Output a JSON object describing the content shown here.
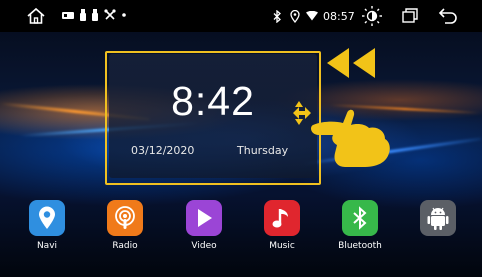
{
  "status_bar": {
    "time": "08:57"
  },
  "clock_widget": {
    "time": "8:42",
    "date": "03/12/2020",
    "day": "Thursday"
  },
  "dock": [
    {
      "label": "Navi",
      "icon": "location-pin-icon",
      "color": "#2f8fe0"
    },
    {
      "label": "Radio",
      "icon": "radio-podcast-icon",
      "color": "#f07a1a"
    },
    {
      "label": "Video",
      "icon": "play-icon",
      "color": "#9b45d6"
    },
    {
      "label": "Music",
      "icon": "music-note-icon",
      "color": "#e0262e"
    },
    {
      "label": "Bluetooth",
      "icon": "bluetooth-icon",
      "color": "#37b84a"
    },
    {
      "label": "",
      "icon": "android-icon",
      "color": "#5b5f66"
    }
  ],
  "colors": {
    "highlight": "#f0c020",
    "status_bar_bg": "#000000"
  }
}
